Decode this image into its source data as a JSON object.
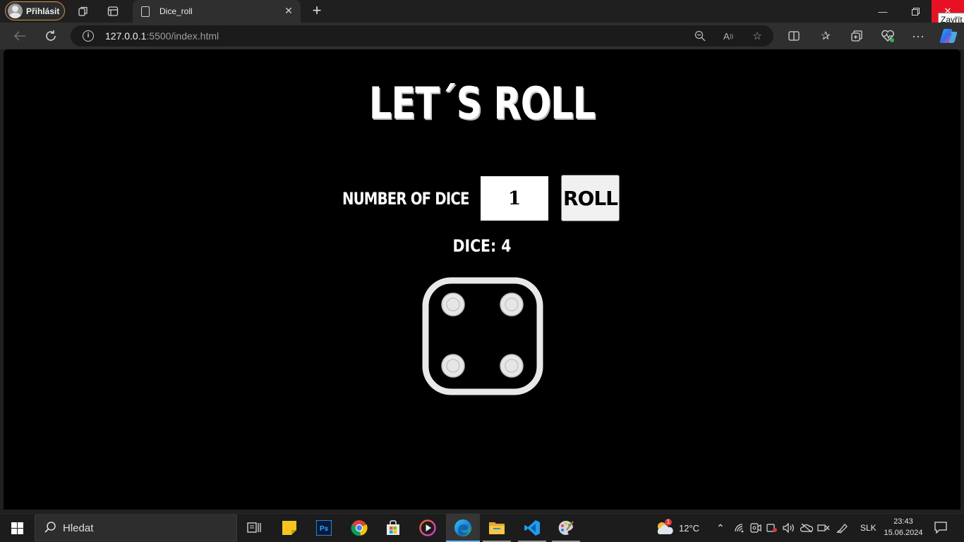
{
  "browser": {
    "profile_label": "Přihlásit",
    "tab_title": "Dice_roll",
    "url_host": "127.0.0.1",
    "url_rest": ":5500/index.html",
    "close_tooltip": "Zavřít"
  },
  "page": {
    "title": "LET´S ROLL",
    "number_label": "NUMBER OF DICE",
    "number_value": "1",
    "roll_label": "ROLL",
    "dice_result": "DICE: 4",
    "die_face_value": 4
  },
  "taskbar": {
    "search_placeholder": "Hledat",
    "weather_temp": "12°C",
    "weather_badge": "1",
    "language": "SLK",
    "time": "23:43",
    "date": "15.06.2024"
  },
  "icons": [
    "profile-avatar-icon",
    "workspaces-icon",
    "tab-actions-icon",
    "page-favicon-icon",
    "back-icon",
    "refresh-icon",
    "site-info-icon",
    "zoom-out-icon",
    "read-aloud-icon",
    "favorite-star-icon",
    "split-screen-icon",
    "favorites-icon",
    "collections-icon",
    "browser-essentials-icon",
    "more-icon",
    "copilot-icon",
    "windows-start-icon",
    "search-icon",
    "task-view-icon",
    "sticky-notes-icon",
    "photoshop-icon",
    "chrome-icon",
    "store-icon",
    "media-player-icon",
    "edge-icon",
    "file-explorer-icon",
    "vscode-icon",
    "paint-icon",
    "weather-icon",
    "chevron-up-icon",
    "wifi-icon",
    "camera-icon",
    "location-icon",
    "volume-icon",
    "onedrive-icon",
    "input-icon",
    "pen-icon",
    "notification-icon"
  ]
}
